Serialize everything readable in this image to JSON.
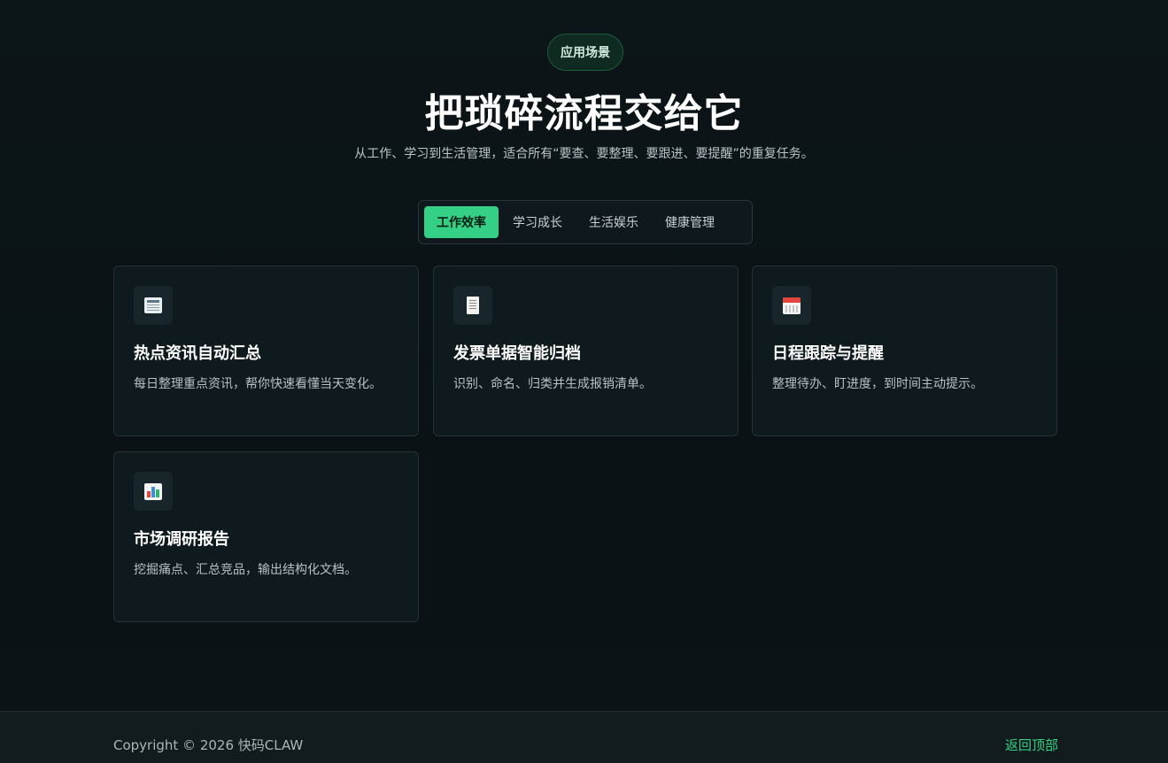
{
  "header": {
    "badge": "应用场景",
    "title": "把琐碎流程交给它",
    "subtitle": "从工作、学习到生活管理，适合所有“要查、要整理、要跟进、要提醒”的重复任务。"
  },
  "tabs": [
    {
      "label": "工作效率",
      "active": true
    },
    {
      "label": "学习成长",
      "active": false
    },
    {
      "label": "生活娱乐",
      "active": false
    },
    {
      "label": "健康管理",
      "active": false
    }
  ],
  "cards": [
    {
      "icon": "newspaper-icon",
      "title": "热点资讯自动汇总",
      "desc": "每日整理重点资讯，帮你快速看懂当天变化。"
    },
    {
      "icon": "receipt-icon",
      "title": "发票单据智能归档",
      "desc": "识别、命名、归类并生成报销清单。"
    },
    {
      "icon": "calendar-icon",
      "title": "日程跟踪与提醒",
      "desc": "整理待办、盯进度，到时间主动提示。"
    },
    {
      "icon": "bar-chart-icon",
      "title": "市场调研报告",
      "desc": "挖掘痛点、汇总竞品，输出结构化文档。"
    }
  ],
  "footer": {
    "copyright": "Copyright © 2026 快码CLAW",
    "back_to_top": "返回顶部"
  },
  "colors": {
    "accent": "#34d085",
    "background": "#0b1316",
    "card_bg": "#0f1a1e"
  }
}
